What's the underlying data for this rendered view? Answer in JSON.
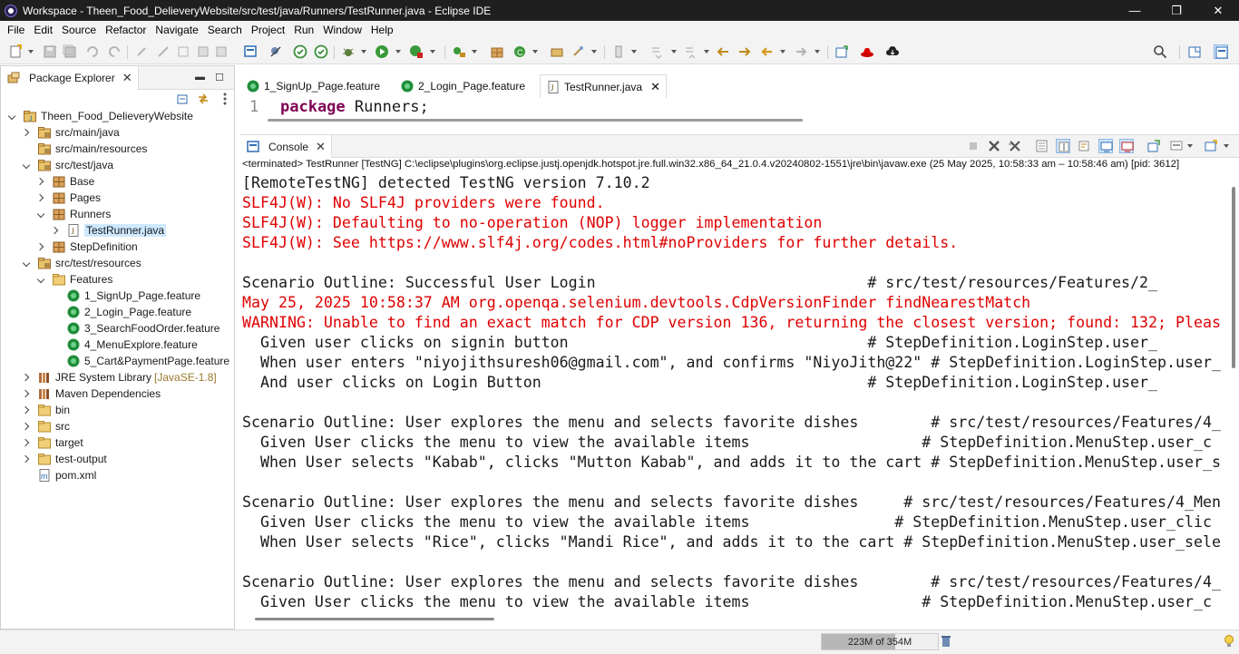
{
  "window": {
    "title": "Workspace - Theen_Food_DelieveryWebsite/src/test/java/Runners/TestRunner.java - Eclipse IDE",
    "minimize": "—",
    "restore": "❐",
    "close": "✕"
  },
  "menubar": [
    "File",
    "Edit",
    "Source",
    "Refactor",
    "Navigate",
    "Search",
    "Project",
    "Run",
    "Window",
    "Help"
  ],
  "package_explorer": {
    "tab_label": "Package Explorer",
    "tree": [
      {
        "label": "Theen_Food_DelieveryWebsite",
        "icon": "project-icon",
        "depth": 0,
        "state": "expanded"
      },
      {
        "label": "src/main/java",
        "icon": "source-folder-icon",
        "depth": 1,
        "state": "collapsed"
      },
      {
        "label": "src/main/resources",
        "icon": "source-folder-icon",
        "depth": 1,
        "state": "none"
      },
      {
        "label": "src/test/java",
        "icon": "source-folder-icon",
        "depth": 1,
        "state": "expanded"
      },
      {
        "label": "Base",
        "icon": "package-icon",
        "depth": 2,
        "state": "collapsed"
      },
      {
        "label": "Pages",
        "icon": "package-icon",
        "depth": 2,
        "state": "collapsed"
      },
      {
        "label": "Runners",
        "icon": "package-icon",
        "depth": 2,
        "state": "expanded"
      },
      {
        "label": "TestRunner.java",
        "icon": "java-file-icon",
        "depth": 3,
        "state": "collapsed",
        "selected": true
      },
      {
        "label": "StepDefinition",
        "icon": "package-icon",
        "depth": 2,
        "state": "collapsed"
      },
      {
        "label": "src/test/resources",
        "icon": "source-folder-icon",
        "depth": 1,
        "state": "expanded"
      },
      {
        "label": "Features",
        "icon": "folder-icon",
        "depth": 2,
        "state": "expanded"
      },
      {
        "label": "1_SignUp_Page.feature",
        "icon": "cucumber-feature-icon",
        "depth": 3,
        "state": "none"
      },
      {
        "label": "2_Login_Page.feature",
        "icon": "cucumber-feature-icon",
        "depth": 3,
        "state": "none"
      },
      {
        "label": "3_SearchFoodOrder.feature",
        "icon": "cucumber-feature-icon",
        "depth": 3,
        "state": "none"
      },
      {
        "label": "4_MenuExplore.feature",
        "icon": "cucumber-feature-icon",
        "depth": 3,
        "state": "none"
      },
      {
        "label": "5_Cart&PaymentPage.feature",
        "icon": "cucumber-feature-icon",
        "depth": 3,
        "state": "none"
      },
      {
        "label": "JRE System Library",
        "sub": "[JavaSE-1.8]",
        "icon": "library-icon",
        "depth": 1,
        "state": "collapsed"
      },
      {
        "label": "Maven Dependencies",
        "icon": "library-icon",
        "depth": 1,
        "state": "collapsed"
      },
      {
        "label": "bin",
        "icon": "folder-icon",
        "depth": 1,
        "state": "collapsed"
      },
      {
        "label": "src",
        "icon": "folder-icon",
        "depth": 1,
        "state": "collapsed"
      },
      {
        "label": "target",
        "icon": "folder-icon",
        "depth": 1,
        "state": "collapsed"
      },
      {
        "label": "test-output",
        "icon": "folder-icon",
        "depth": 1,
        "state": "collapsed"
      },
      {
        "label": "pom.xml",
        "icon": "xml-file-icon",
        "depth": 1,
        "state": "none"
      }
    ]
  },
  "editor": {
    "tabs": [
      {
        "label": "1_SignUp_Page.feature",
        "icon": "cucumber-feature-icon",
        "active": false
      },
      {
        "label": "2_Login_Page.feature",
        "icon": "cucumber-feature-icon",
        "active": false
      },
      {
        "label": "TestRunner.java",
        "icon": "java-file-icon",
        "active": true
      }
    ],
    "line_number": "1",
    "keyword": "package",
    "code_rest": " Runners;"
  },
  "console": {
    "tab_label": "Console",
    "status": "<terminated> TestRunner [TestNG] C:\\eclipse\\plugins\\org.eclipse.justj.openjdk.hotspot.jre.full.win32.x86_64_21.0.4.v20240802-1551\\jre\\bin\\javaw.exe  (25 May 2025, 10:58:33 am – 10:58:46 am) [pid: 3612]",
    "lines": [
      {
        "text": "[RemoteTestNG] detected TestNG version 7.10.2",
        "color": "black"
      },
      {
        "text": "SLF4J(W): No SLF4J providers were found.",
        "color": "red"
      },
      {
        "text": "SLF4J(W): Defaulting to no-operation (NOP) logger implementation",
        "color": "red"
      },
      {
        "text": "SLF4J(W): See https://www.slf4j.org/codes.html#noProviders for further details.",
        "color": "red"
      },
      {
        "text": "",
        "color": "black"
      },
      {
        "text": "Scenario Outline: Successful User Login                              # src/test/resources/Features/2_",
        "color": "black"
      },
      {
        "text": "May 25, 2025 10:58:37 AM org.openqa.selenium.devtools.CdpVersionFinder findNearestMatch",
        "color": "red"
      },
      {
        "text": "WARNING: Unable to find an exact match for CDP version 136, returning the closest version; found: 132; Pleas",
        "color": "red"
      },
      {
        "text": "  Given user clicks on signin button                                 # StepDefinition.LoginStep.user_",
        "color": "black"
      },
      {
        "text": "  When user enters \"niyojithsuresh06@gmail.com\", and confirms \"NiyoJith@22\" # StepDefinition.LoginStep.user_",
        "color": "black"
      },
      {
        "text": "  And user clicks on Login Button                                    # StepDefinition.LoginStep.user_",
        "color": "black"
      },
      {
        "text": "",
        "color": "black"
      },
      {
        "text": "Scenario Outline: User explores the menu and selects favorite dishes        # src/test/resources/Features/4_",
        "color": "black"
      },
      {
        "text": "  Given User clicks the menu to view the available items                   # StepDefinition.MenuStep.user_c",
        "color": "black"
      },
      {
        "text": "  When User selects \"Kabab\", clicks \"Mutton Kabab\", and adds it to the cart # StepDefinition.MenuStep.user_s",
        "color": "black"
      },
      {
        "text": "",
        "color": "black"
      },
      {
        "text": "Scenario Outline: User explores the menu and selects favorite dishes     # src/test/resources/Features/4_Men",
        "color": "black"
      },
      {
        "text": "  Given User clicks the menu to view the available items                # StepDefinition.MenuStep.user_clic",
        "color": "black"
      },
      {
        "text": "  When User selects \"Rice\", clicks \"Mandi Rice\", and adds it to the cart # StepDefinition.MenuStep.user_sele",
        "color": "black"
      },
      {
        "text": "",
        "color": "black"
      },
      {
        "text": "Scenario Outline: User explores the menu and selects favorite dishes        # src/test/resources/Features/4_",
        "color": "black"
      },
      {
        "text": "  Given User clicks the menu to view the available items                   # StepDefinition.MenuStep.user_c",
        "color": "black"
      }
    ]
  },
  "statusbar": {
    "heap_label": "223M of 354M",
    "heap_used_fraction": 0.63
  },
  "colors": {
    "accent_red": "#e00000",
    "keyword": "#7f0055",
    "selection": "#cde8ff"
  }
}
